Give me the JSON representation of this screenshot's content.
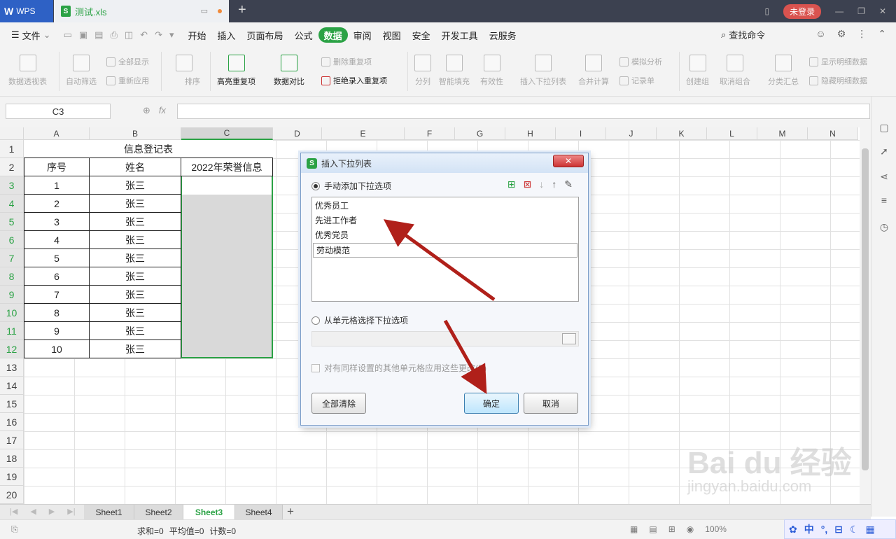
{
  "titlebar": {
    "app": "WPS",
    "tab_name": "测试.xls",
    "login": "未登录"
  },
  "menu": {
    "file": "文件",
    "items": [
      "开始",
      "插入",
      "页面布局",
      "公式",
      "数据",
      "审阅",
      "视图",
      "安全",
      "开发工具",
      "云服务"
    ],
    "active": "数据",
    "search": "查找命令"
  },
  "ribbon": {
    "pivot": "数据透视表",
    "autofilter": "自动筛选",
    "show_all": "全部显示",
    "reapply": "重新应用",
    "sort": "排序",
    "highlight_dup": "高亮重复项",
    "compare": "数据对比",
    "remove_dup": "删除重复项",
    "reject_dup": "拒绝录入重复项",
    "split": "分列",
    "smart_fill": "智能填充",
    "validity": "有效性",
    "insert_dropdown": "插入下拉列表",
    "consolidate": "合并计算",
    "what_if": "模拟分析",
    "record": "记录单",
    "group": "创建组",
    "ungroup": "取消组合",
    "subtotal": "分类汇总",
    "show_detail": "显示明细数据",
    "hide_detail": "隐藏明细数据"
  },
  "formula": {
    "namebox": "C3",
    "fx": "fx"
  },
  "columns": [
    "A",
    "B",
    "C",
    "D",
    "E",
    "F",
    "G",
    "H",
    "I",
    "J",
    "K",
    "L",
    "M",
    "N"
  ],
  "rows": [
    "1",
    "2",
    "3",
    "4",
    "5",
    "6",
    "7",
    "8",
    "9",
    "10",
    "11",
    "12",
    "13",
    "14",
    "15",
    "16",
    "17",
    "18",
    "19",
    "20"
  ],
  "table": {
    "title": "信息登记表",
    "headers": [
      "序号",
      "姓名",
      "2022年荣誉信息"
    ],
    "data": [
      [
        "1",
        "张三"
      ],
      [
        "2",
        "张三"
      ],
      [
        "3",
        "张三"
      ],
      [
        "4",
        "张三"
      ],
      [
        "5",
        "张三"
      ],
      [
        "6",
        "张三"
      ],
      [
        "7",
        "张三"
      ],
      [
        "8",
        "张三"
      ],
      [
        "9",
        "张三"
      ],
      [
        "10",
        "张三"
      ]
    ]
  },
  "sheets": [
    "Sheet1",
    "Sheet2",
    "Sheet3",
    "Sheet4"
  ],
  "active_sheet": "Sheet3",
  "status": {
    "sum": "求和=0",
    "avg": "平均值=0",
    "count": "计数=0",
    "zoom": "100%"
  },
  "dialog": {
    "title": "插入下拉列表",
    "manual_label": "手动添加下拉选项",
    "options": [
      "优秀员工",
      "先进工作者",
      "优秀党员",
      "劳动模范"
    ],
    "from_cells_label": "从单元格选择下拉选项",
    "apply_all_label": "对有同样设置的其他单元格应用这些更改(P)",
    "clear_all": "全部清除",
    "ok": "确定",
    "cancel": "取消"
  },
  "ime": {
    "lang": "中"
  },
  "watermark": {
    "brand": "Bai du 经验",
    "url": "jingyan.baidu.com"
  }
}
